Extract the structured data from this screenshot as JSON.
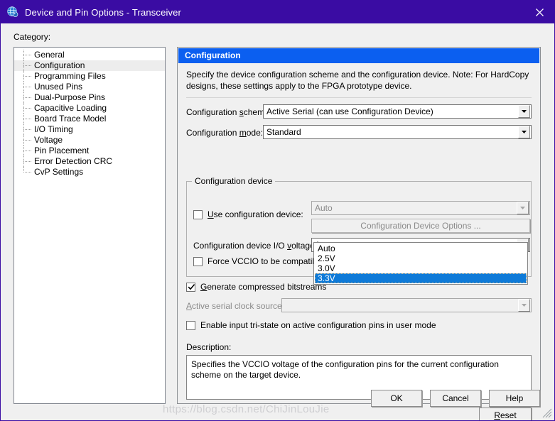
{
  "window": {
    "title": "Device and Pin Options - Transceiver",
    "icon": "quartus-globe-icon",
    "close_label": "Close",
    "accent_titlebar": "#3a0ca3",
    "accent_header": "#0b5ff0",
    "accent_selection": "#0e7ad8"
  },
  "category": {
    "label": "Category:",
    "items": [
      {
        "label": "General",
        "selected": false
      },
      {
        "label": "Configuration",
        "selected": true
      },
      {
        "label": "Programming Files",
        "selected": false
      },
      {
        "label": "Unused Pins",
        "selected": false
      },
      {
        "label": "Dual-Purpose Pins",
        "selected": false
      },
      {
        "label": "Capacitive Loading",
        "selected": false
      },
      {
        "label": "Board Trace Model",
        "selected": false
      },
      {
        "label": "I/O Timing",
        "selected": false
      },
      {
        "label": "Voltage",
        "selected": false
      },
      {
        "label": "Pin Placement",
        "selected": false
      },
      {
        "label": "Error Detection CRC",
        "selected": false
      },
      {
        "label": "CvP Settings",
        "selected": false
      }
    ]
  },
  "panel": {
    "header": "Configuration",
    "description": "Specify the device configuration scheme and the configuration device. Note: For HardCopy designs, these settings apply to the FPGA prototype device.",
    "config_scheme": {
      "label": "Configuration scheme:",
      "value": "Active Serial (can use Configuration Device)"
    },
    "config_mode": {
      "label": "Configuration mode:",
      "value": "Standard"
    },
    "config_device_group": {
      "title": "Configuration device",
      "use_config_device": {
        "label": "Use configuration device:",
        "checked": false
      },
      "device_combo_value": "Auto",
      "device_options_button": "Configuration Device Options ...",
      "io_voltage": {
        "label": "Configuration device I/O voltage:",
        "value": "Auto",
        "open": true,
        "options": [
          "Auto",
          "2.5V",
          "3.0V",
          "3.3V"
        ],
        "highlighted": "3.3V"
      },
      "force_vccio": {
        "label": "Force VCCIO to be compatible with configuration I/O voltage",
        "checked": false
      }
    },
    "generate_compressed": {
      "label": "Generate compressed bitstreams",
      "checked": true
    },
    "active_serial_clock": {
      "label": "Active serial clock source:",
      "value": ""
    },
    "enable_tri_state": {
      "label": "Enable input tri-state on active configuration pins in user mode",
      "checked": false
    },
    "description_box": {
      "label": "Description:",
      "text": "Specifies the VCCIO voltage of the configuration pins for the current configuration scheme on the target device."
    },
    "reset_button": "Reset"
  },
  "footer": {
    "ok": "OK",
    "cancel": "Cancel",
    "help": "Help"
  },
  "watermark": "https://blog.csdn.net/ChiJinLouJie"
}
